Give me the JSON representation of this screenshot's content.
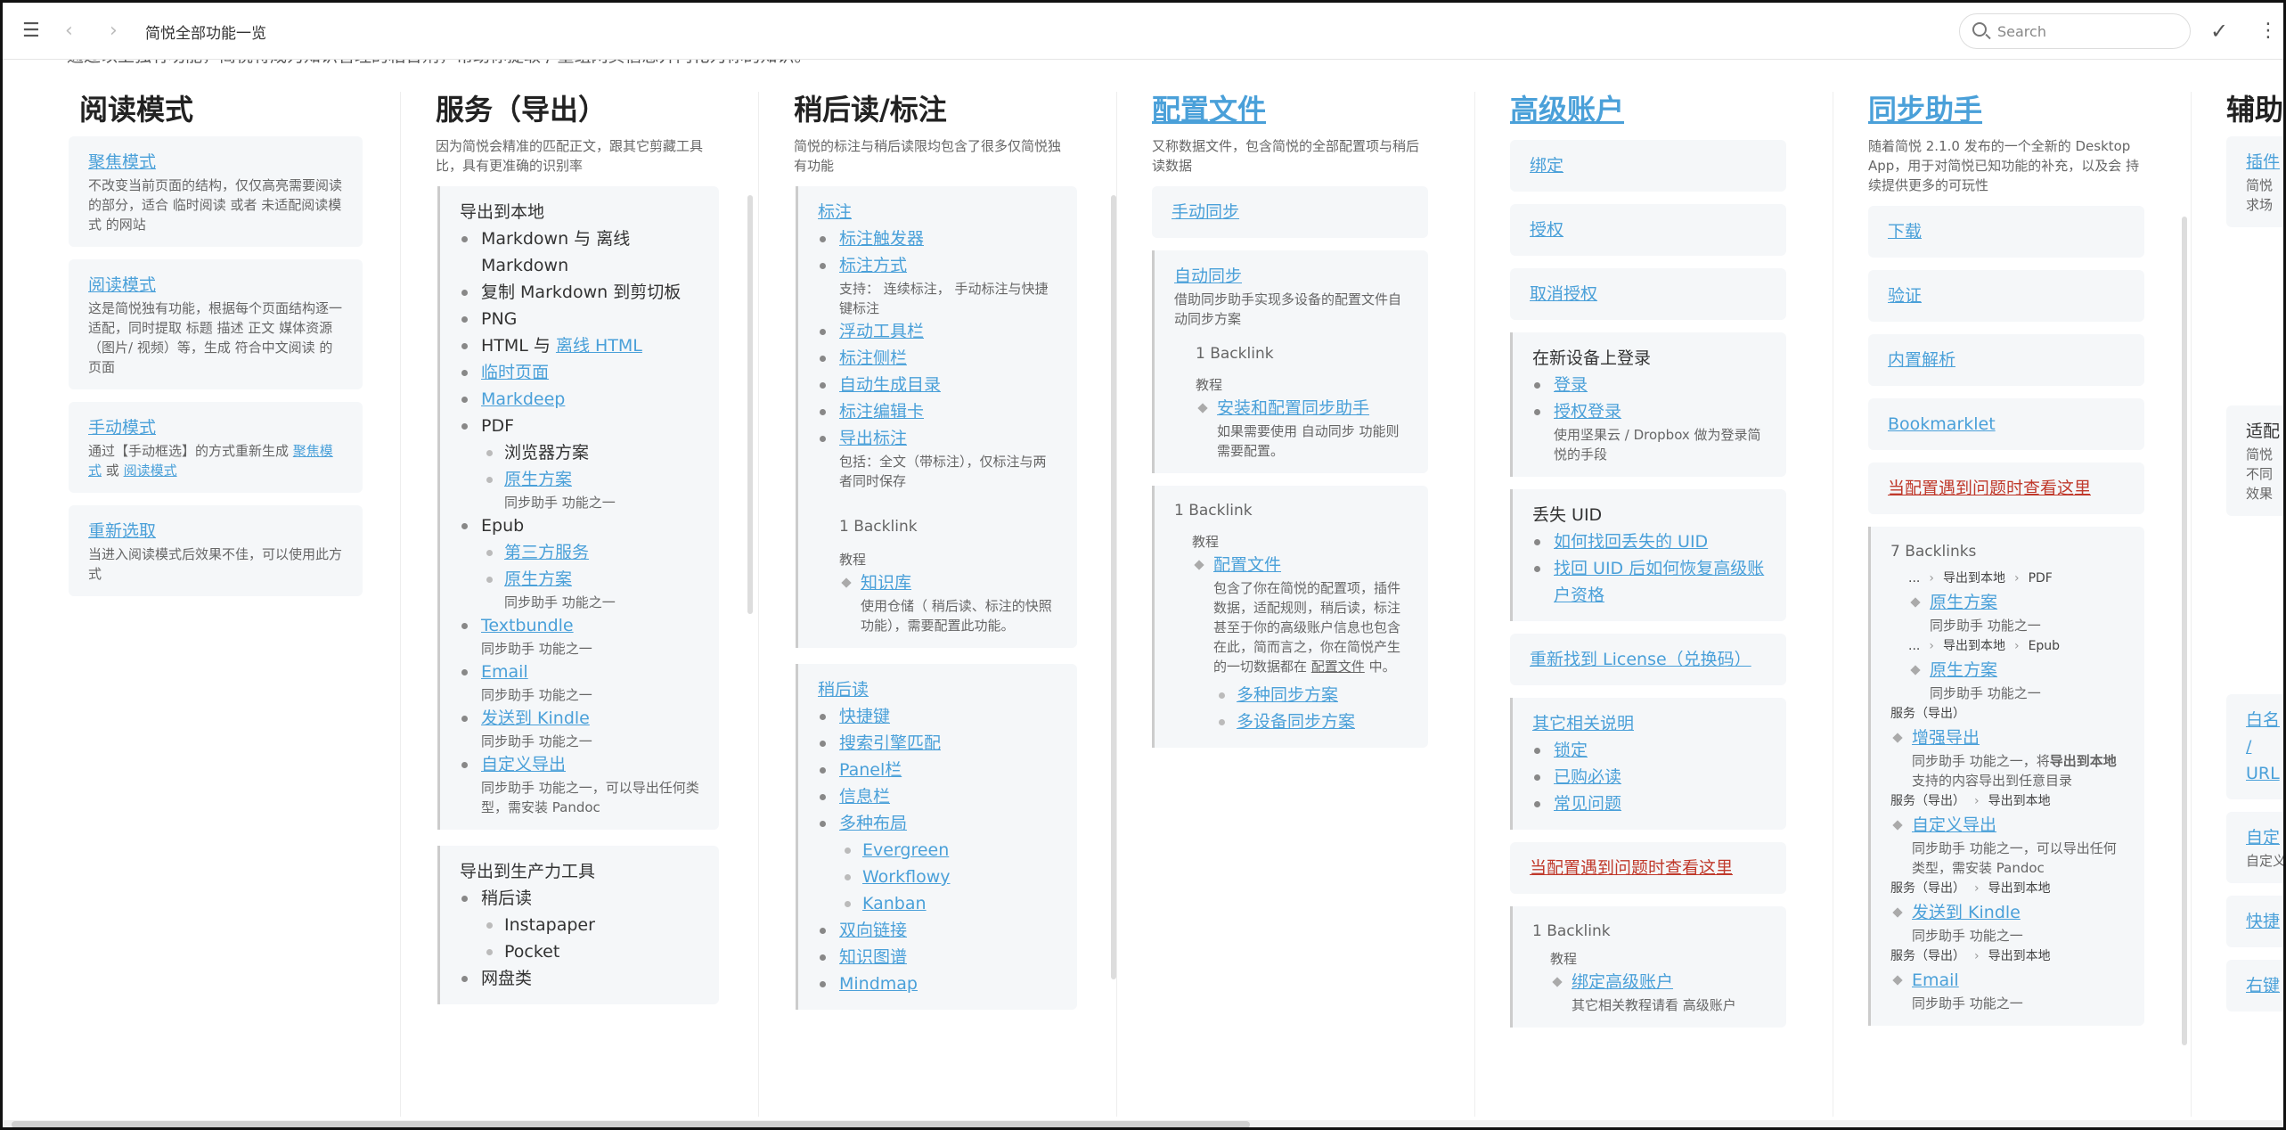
{
  "app": {
    "title": "简悦全部功能一览",
    "search_placeholder": "Search"
  },
  "intro": "通过以上独有功能，简悦将成为知识管理的粘合剂，帮助你提取 / 重组网页信息并内化为你的知识。",
  "col1": {
    "heading": "阅读模式",
    "cards": [
      {
        "link": "聚焦模式",
        "desc": "不改变当前页面的结构，仅仅高亮需要阅读的部分，适合 临时阅读 或者 未适配阅读模式 的网站"
      },
      {
        "link": "阅读模式",
        "desc": "这是简悦独有功能，根据每个页面结构逐一适配，同时提取 标题 描述 正文 媒体资源（图片/ 视频）等，生成 符合中文阅读 的页面"
      },
      {
        "link": "手动模式",
        "desc_pre": "通过【手动框选】的方式重新生成 ",
        "desc_l1": "聚焦模式",
        "desc_mid": " 或 ",
        "desc_l2": "阅读模式"
      },
      {
        "link": "重新选取",
        "desc": "当进入阅读模式后效果不佳，可以使用此方式"
      }
    ]
  },
  "col2": {
    "heading": "服务（导出）",
    "desc": "因为简悦会精准的匹配正文，跟其它剪藏工具比，具有更准确的识别率",
    "local": {
      "title": "导出到本地",
      "md": "Markdown 与 离线 Markdown",
      "copy": "复制 Markdown 到剪切板",
      "png": "PNG",
      "html_pre": "HTML 与 ",
      "html_link": "离线 HTML",
      "temp": "临时页面",
      "markdeep": "Markdeep",
      "pdf": "PDF",
      "browser": "浏览器方案",
      "native": "原生方案",
      "helper": "同步助手 功能之一",
      "epub": "Epub",
      "third": "第三方服务",
      "native2": "原生方案",
      "textbundle": "Textbundle",
      "email": "Email",
      "kindle": "发送到 Kindle",
      "custom": "自定义导出",
      "custom_desc": "同步助手 功能之一，可以导出任何类型，需安装 Pandoc"
    },
    "prod": {
      "title": "导出到生产力工具",
      "later": "稍后读",
      "instapaper": "Instapaper",
      "pocket": "Pocket",
      "disk": "网盘类"
    }
  },
  "col3": {
    "heading": "稍后读/标注",
    "desc": "简悦的标注与稍后读限均包含了很多仅简悦独有功能",
    "annot": {
      "title": "标注",
      "trigger": "标注触发器",
      "mode": "标注方式",
      "mode_desc": "支持： 连续标注， 手动标注与快捷键标注",
      "float": "浮动工具栏",
      "side": "标注侧栏",
      "toc": "自动生成目录",
      "editor": "标注编辑卡",
      "export": "导出标注",
      "export_desc": "包括：全文（带标注），仅标注与两者同时保存",
      "backlink": "1 Backlink",
      "tutorial": "教程",
      "kb": "知识库",
      "kb_desc": "使用仓储（ 稍后读、标注的快照功能），需要配置此功能。"
    },
    "later": {
      "title": "稍后读",
      "shortcut": "快捷键",
      "engine": "搜索引擎匹配",
      "panel": "Panel栏",
      "info": "信息栏",
      "layout": "多种布局",
      "evergreen": "Evergreen",
      "workflowy": "Workflowy",
      "kanban": "Kanban",
      "bilink": "双向链接",
      "graph": "知识图谱",
      "mindmap": "Mindmap"
    }
  },
  "col4": {
    "heading": "配置文件",
    "desc": "又称数据文件，包含简悦的全部配置项与稍后读数据",
    "manual": "手动同步",
    "auto": "自动同步",
    "auto_desc": "借助同步助手实现多设备的配置文件自动同步方案",
    "auto_backlink": "1 Backlink",
    "auto_tutorial": "教程",
    "auto_install": "安装和配置同步助手",
    "auto_install_desc": "如果需要使用 自动同步 功能则需要配置。",
    "bl": {
      "count": "1 Backlink",
      "tutorial": "教程",
      "link": "配置文件",
      "desc_pre": "包含了你在简悦的配置项，插件数据，适配规则，稍后读，标注甚至于你的高级账户信息也包含在此，简而言之，你在简悦产生的一切数据都在 ",
      "desc_u": "配置文件",
      "desc_post": " 中。",
      "multi": "多种同步方案",
      "device": "多设备同步方案"
    }
  },
  "col5": {
    "heading": "高级账户",
    "bind": "绑定",
    "auth": "授权",
    "unauth": "取消授权",
    "newdev": {
      "title": "在新设备上登录",
      "login": "登录",
      "authlogin": "授权登录",
      "authlogin_desc": "使用坚果云 / Dropbox 做为登录简悦的手段"
    },
    "uid": {
      "title": "丢失 UID",
      "find": "如何找回丢失的 UID",
      "restore": "找回 UID 后如何恢复高级账户资格"
    },
    "license": "重新找到 License（兑换码）",
    "other": {
      "title": "其它相关说明",
      "lock": "锁定",
      "bought": "已购必读",
      "faq": "常见问题"
    },
    "trouble": "当配置遇到问题时查看这里",
    "bl": {
      "count": "1 Backlink",
      "tutorial": "教程",
      "link": "绑定高级账户",
      "desc": "其它相关教程请看 高级账户"
    }
  },
  "col6": {
    "heading": "同步助手",
    "desc": "随着简悦 2.1.0 发布的一个全新的 Desktop App，用于对简悦已知功能的补充，以及会 持续提供更多的可玩性",
    "download": "下载",
    "verify": "验证",
    "parse": "内置解析",
    "bookmarklet": "Bookmarklet",
    "trouble": "当配置遇到问题时查看这里",
    "bl": {
      "count": "7 Backlinks",
      "dots": "...",
      "local": "导出到本地",
      "pdf": "PDF",
      "native": "原生方案",
      "helper": "同步助手 功能之一",
      "epub": "Epub",
      "svc": "服务（导出）",
      "enh": "增强导出",
      "enh_pre": "同步助手 功能之一，将",
      "enh_b": "导出到本地",
      "enh_post": "支持的内容导出到任意目录",
      "custom": "自定义导出",
      "custom_desc": "同步助手 功能之一，可以导出任何类型，需安装 Pandoc",
      "kindle": "发送到 Kindle",
      "email": "Email"
    }
  },
  "col7": {
    "heading": "辅助",
    "plugin": "插件",
    "plugin_desc": "简悦求场",
    "adapt": "适配",
    "adapt_desc": "简悦不同效果",
    "whitelist": "白名 / URL",
    "custom": "自定",
    "custom_desc": "自定义",
    "shortcut": "快捷",
    "right": "右键"
  }
}
